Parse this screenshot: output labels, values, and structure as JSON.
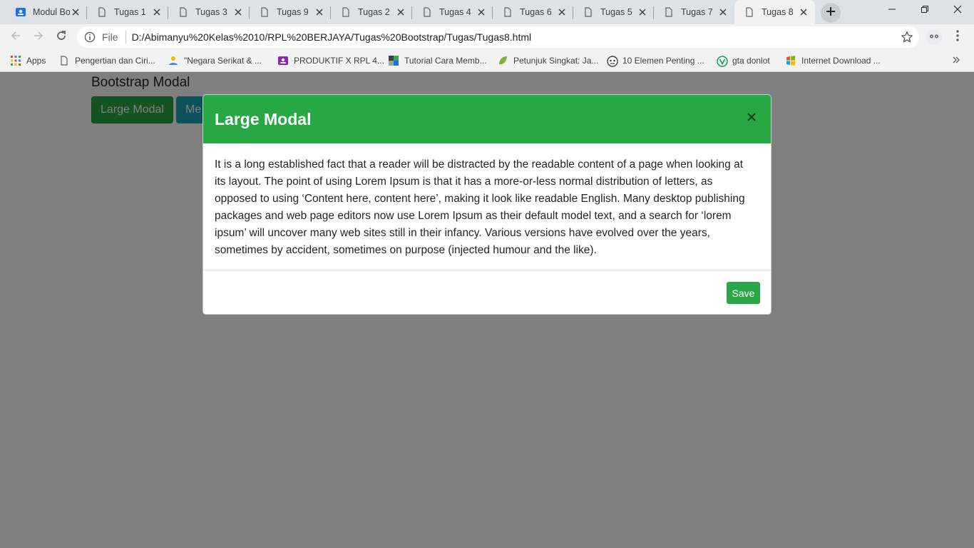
{
  "browser": {
    "tabs": [
      {
        "title": "Modul Bootstrap",
        "icon": "classroom-icon",
        "active": false
      },
      {
        "title": "Tugas 1",
        "icon": "document-icon",
        "active": false
      },
      {
        "title": "Tugas 3",
        "icon": "document-icon",
        "active": false
      },
      {
        "title": "Tugas 9",
        "icon": "document-icon",
        "active": false
      },
      {
        "title": "Tugas 2",
        "icon": "document-icon",
        "active": false
      },
      {
        "title": "Tugas 4",
        "icon": "document-icon",
        "active": false
      },
      {
        "title": "Tugas 6",
        "icon": "document-icon",
        "active": false
      },
      {
        "title": "Tugas 5",
        "icon": "document-icon",
        "active": false
      },
      {
        "title": "Tugas 7",
        "icon": "document-icon",
        "active": false
      },
      {
        "title": "Tugas 8",
        "icon": "document-icon",
        "active": true
      }
    ],
    "address": {
      "scheme_label": "File",
      "url": "D:/Abimanyu%20Kelas%2010/RPL%20BERJAYA/Tugas%20Bootstrap/Tugas/Tugas8.html"
    },
    "bookmarks": [
      {
        "label": "Apps",
        "icon": "apps-grid-icon"
      },
      {
        "label": "Pengertian dan Ciri...",
        "icon": "document-icon"
      },
      {
        "label": "\"Negara Serikat & ...",
        "icon": "site-icon"
      },
      {
        "label": "PRODUKTIF X RPL 4...",
        "icon": "classroom-icon"
      },
      {
        "label": "Tutorial Cara Memb...",
        "icon": "site-icon"
      },
      {
        "label": "Petunjuk Singkat: Ja...",
        "icon": "leaf-icon"
      },
      {
        "label": "10 Elemen Penting ...",
        "icon": "face-icon"
      },
      {
        "label": "gta donlot",
        "icon": "v-logo-icon"
      },
      {
        "label": "Internet Download ...",
        "icon": "windows-icon"
      }
    ]
  },
  "page": {
    "title": "Bootstrap Modal",
    "buttons": {
      "large": "Large Modal",
      "medium": "Me"
    }
  },
  "modal": {
    "title": "Large Modal",
    "close_glyph": "×",
    "body": "It is a long established fact that a reader will be distracted by the readable content of a page when looking at its layout. The point of using Lorem Ipsum is that it has a more-or-less normal distribution of letters, as opposed to using ‘Content here, content here’, making it look like readable English. Many desktop publishing packages and web page editors now use Lorem Ipsum as their default model text, and a search for ‘lorem ipsum’ will uncover many web sites still in their infancy. Various versions have evolved over the years, sometimes by accident, sometimes on purpose (injected humour and the like).",
    "save_label": "Save"
  },
  "colors": {
    "success": "#28a745",
    "info": "#17a2b8",
    "backdrop": "rgba(0,0,0,0.5)"
  }
}
